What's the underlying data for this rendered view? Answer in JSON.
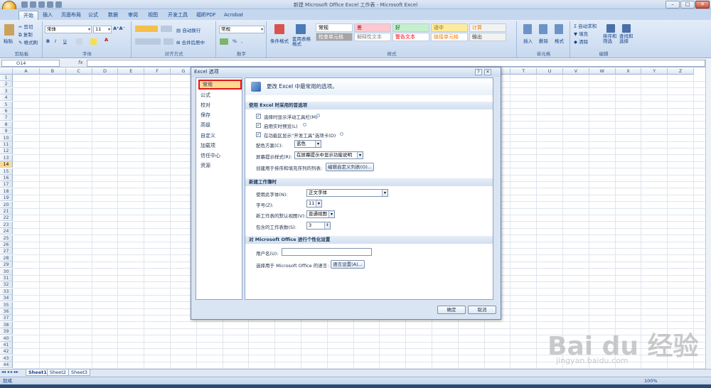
{
  "window": {
    "title": "新建 Microsoft Office Excel 工作表 - Microsoft Excel",
    "minimize": "–",
    "maximize": "□",
    "close": "✕"
  },
  "tabs": [
    "开始",
    "插入",
    "页面布局",
    "公式",
    "数据",
    "审阅",
    "视图",
    "开发工具",
    "福昕PDF",
    "Acrobat"
  ],
  "ribbon": {
    "clipboard": {
      "paste": "粘贴",
      "cut": "剪切",
      "copy": "复制",
      "format_painter": "格式刷",
      "label": "剪贴板"
    },
    "font": {
      "name": "宋体",
      "size": "11",
      "label": "字体",
      "bold": "B",
      "italic": "I",
      "underline": "U"
    },
    "alignment": {
      "wrap": "自动换行",
      "merge": "合并后居中",
      "label": "对齐方式"
    },
    "number": {
      "format": "常规",
      "percent": "%",
      "comma": ",",
      "label": "数字"
    },
    "styles": {
      "conditional": "条件格式",
      "table": "套用表格格式",
      "cells": [
        {
          "text": "常规",
          "bg": "#ffffff",
          "color": "#000000"
        },
        {
          "text": "差",
          "bg": "#ffc7ce",
          "color": "#9c0006"
        },
        {
          "text": "好",
          "bg": "#c6efce",
          "color": "#006100"
        },
        {
          "text": "适中",
          "bg": "#ffeb9c",
          "color": "#9c6500"
        },
        {
          "text": "计算",
          "bg": "#f2f2f2",
          "color": "#fa7d00"
        },
        {
          "text": "检查单元格",
          "bg": "#a5a5a5",
          "color": "#ffffff"
        },
        {
          "text": "解释性文本",
          "bg": "#ffffff",
          "color": "#7f7f7f"
        },
        {
          "text": "警告文本",
          "bg": "#ffffff",
          "color": "#ff0000"
        },
        {
          "text": "链接单元格",
          "bg": "#ffffff",
          "color": "#fa7d00"
        },
        {
          "text": "输出",
          "bg": "#f2f2f2",
          "color": "#3f3f3f"
        }
      ],
      "label": "样式"
    },
    "cells_group": {
      "insert": "插入",
      "delete": "删除",
      "format": "格式",
      "label": "单元格"
    },
    "editing": {
      "autosum": "Σ 自动求和",
      "fill": "填充",
      "clear": "清除",
      "sort": "排序和筛选",
      "find": "查找和选择",
      "label": "编辑"
    }
  },
  "formula_bar": {
    "cell": "O14",
    "fx": "fx"
  },
  "columns": [
    "A",
    "B",
    "C",
    "D",
    "E",
    "F",
    "G",
    "H",
    "I",
    "J",
    "K",
    "L",
    "M",
    "N",
    "O",
    "P",
    "Q",
    "R",
    "S",
    "T",
    "U",
    "V",
    "W",
    "X",
    "Y",
    "Z"
  ],
  "rows": [
    "1",
    "2",
    "3",
    "4",
    "5",
    "6",
    "7",
    "8",
    "9",
    "10",
    "11",
    "12",
    "13",
    "14",
    "15",
    "16",
    "17",
    "18",
    "19",
    "20",
    "21",
    "22",
    "23",
    "24",
    "25",
    "26",
    "27",
    "28",
    "29",
    "30",
    "31",
    "32",
    "33",
    "34",
    "35",
    "36",
    "37",
    "38",
    "39",
    "40",
    "41",
    "42",
    "43",
    "44"
  ],
  "selected_row": "14",
  "sheets": [
    "Sheet1",
    "Sheet2",
    "Sheet3"
  ],
  "status": {
    "ready": "就绪",
    "zoom": "100%"
  },
  "dialog": {
    "title": "Excel 选项",
    "help": "?",
    "close": "✕",
    "categories": [
      "常用",
      "公式",
      "校对",
      "保存",
      "高级",
      "自定义",
      "加载项",
      "信任中心",
      "资源"
    ],
    "header": "更改 Excel 中最常用的选项。",
    "section1": "使用 Excel 时采用的首选项",
    "opt_minitoolbar": "选择时显示浮动工具栏(M)",
    "opt_livepreview": "启用实时预览(L)",
    "opt_devtab": "在功能区显示“开发工具”选项卡(D)",
    "color_scheme_label": "配色方案(C):",
    "color_scheme_value": "蓝色",
    "tooltip_label": "屏幕提示样式(R):",
    "tooltip_value": "在屏幕提示中显示功能说明",
    "custom_list_label": "创建用于排序和填充序列的列表:",
    "custom_list_button": "编辑自定义列表(O)...",
    "section2": "新建工作簿时",
    "font_label": "使用此字体(N):",
    "font_value": "正文字体",
    "size_label": "字号(Z):",
    "size_value": "11",
    "view_label": "新工作表的默认视图(V):",
    "view_value": "普通视图",
    "sheets_label": "包含的工作表数(S):",
    "sheets_value": "3",
    "section3": "对 Microsoft Office 进行个性化设置",
    "username_label": "用户名(U):",
    "username_value": "",
    "lang_label": "选择用于 Microsoft Office 的语言:",
    "lang_button": "语言设置(A)...",
    "ok": "确定",
    "cancel": "取消"
  },
  "watermark": {
    "logo": "Bai du 经验",
    "url": "jingyan.baidu.com"
  }
}
